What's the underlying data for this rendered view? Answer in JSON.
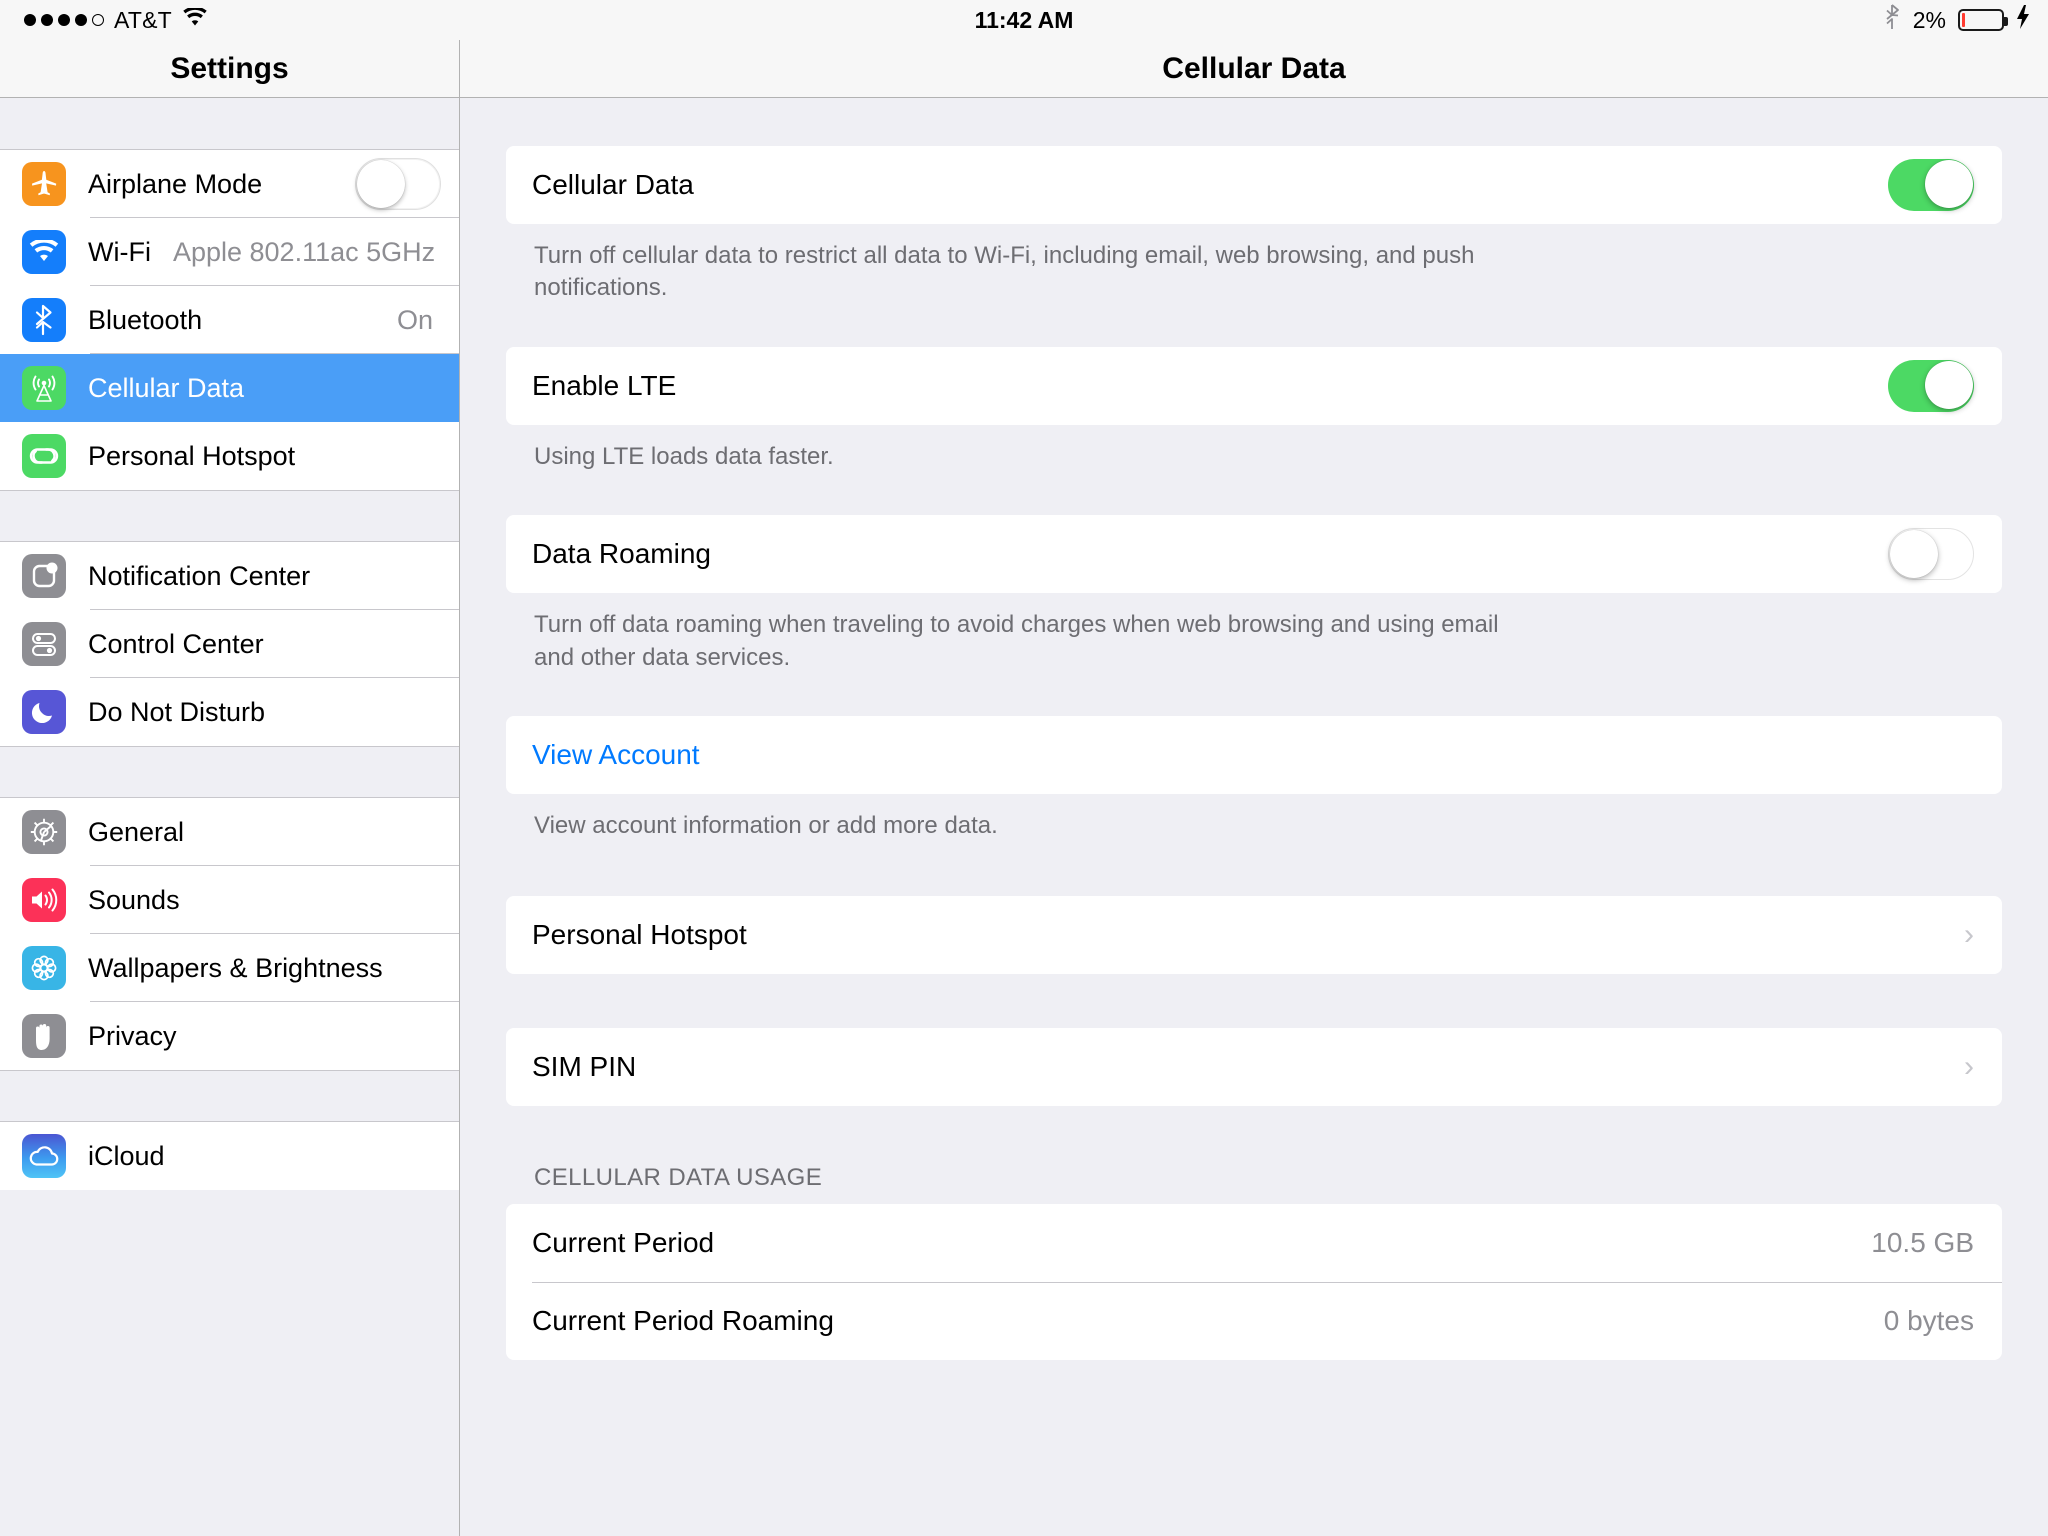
{
  "status_bar": {
    "signal_dots_filled": 4,
    "signal_dots_total": 5,
    "carrier": "AT&T",
    "wifi_icon": "wifi-icon",
    "time": "11:42 AM",
    "bluetooth_icon": "bluetooth-icon",
    "battery_percent": "2%",
    "battery_icon": "battery-icon",
    "charging_icon": "lightning-bolt-icon"
  },
  "sidebar": {
    "title": "Settings",
    "groups": [
      {
        "items": [
          {
            "label": "Airplane Mode",
            "icon": "airplane-icon",
            "icon_color": "#f7941e",
            "accessory": "toggle-off"
          },
          {
            "label": "Wi-Fi",
            "icon": "wifi-icon",
            "icon_color": "#147efb",
            "value": "Apple 802.11ac 5GHz"
          },
          {
            "label": "Bluetooth",
            "icon": "bluetooth-icon",
            "icon_color": "#147efb",
            "value_right": "On"
          },
          {
            "label": "Cellular Data",
            "icon": "cell-tower-icon",
            "icon_color": "#4cd964",
            "selected": true
          },
          {
            "label": "Personal Hotspot",
            "icon": "hotspot-link-icon",
            "icon_color": "#4cd964"
          }
        ]
      },
      {
        "items": [
          {
            "label": "Notification Center",
            "icon": "notification-center-icon",
            "icon_color": "#8e8e93"
          },
          {
            "label": "Control Center",
            "icon": "control-center-icon",
            "icon_color": "#8e8e93"
          },
          {
            "label": "Do Not Disturb",
            "icon": "moon-icon",
            "icon_color": "#5756d6"
          }
        ]
      },
      {
        "items": [
          {
            "label": "General",
            "icon": "gear-icon",
            "icon_color": "#8e8e93"
          },
          {
            "label": "Sounds",
            "icon": "speaker-icon",
            "icon_color": "#fc3158"
          },
          {
            "label": "Wallpapers & Brightness",
            "icon": "flower-icon",
            "icon_color": "#38b5e6"
          },
          {
            "label": "Privacy",
            "icon": "hand-icon",
            "icon_color": "#8e8e93"
          }
        ]
      },
      {
        "items": [
          {
            "label": "iCloud",
            "icon": "cloud-icon",
            "icon_color": "#3d8ff0"
          }
        ]
      }
    ],
    "selection_color": "#4a9ef7"
  },
  "detail": {
    "title": "Cellular Data",
    "toggle_on_color": "#4cd964",
    "link_color": "#007aff",
    "rows": {
      "cellular_data": {
        "label": "Cellular Data",
        "state": "on"
      },
      "cellular_data_note": "Turn off cellular data to restrict all data to Wi-Fi, including email, web browsing, and push notifications.",
      "enable_lte": {
        "label": "Enable LTE",
        "state": "on"
      },
      "enable_lte_note": "Using LTE loads data faster.",
      "data_roaming": {
        "label": "Data Roaming",
        "state": "off"
      },
      "data_roaming_note": "Turn off data roaming when traveling to avoid charges when web browsing and using email and other data services.",
      "view_account": {
        "label": "View Account"
      },
      "view_account_note": "View account information or add more data.",
      "personal_hotspot": {
        "label": "Personal Hotspot",
        "accessory": "chevron-right-icon"
      },
      "sim_pin": {
        "label": "SIM PIN",
        "accessory": "chevron-right-icon"
      }
    },
    "usage_section": {
      "header": "CELLULAR DATA USAGE",
      "rows": [
        {
          "label": "Current Period",
          "value": "10.5 GB"
        },
        {
          "label": "Current Period Roaming",
          "value": "0 bytes"
        }
      ]
    }
  }
}
